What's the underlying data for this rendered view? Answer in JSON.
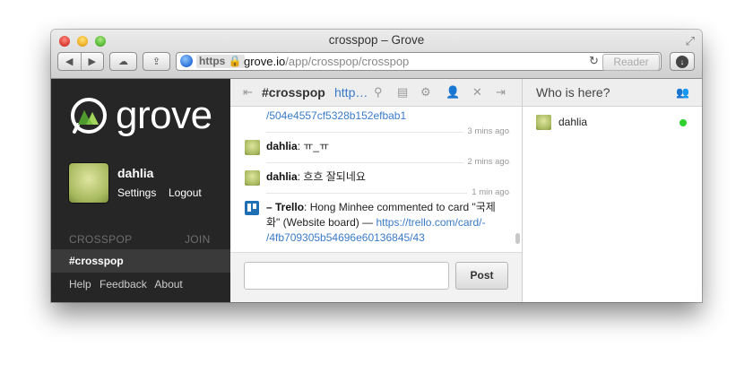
{
  "window": {
    "title": "crosspop – Grove"
  },
  "toolbar": {
    "back_icon": "back-arrow-icon",
    "forward_icon": "forward-arrow-icon",
    "cloud_icon": "cloud-icon",
    "share_icon": "share-icon",
    "url_scheme": "https",
    "url_domain": "grove.io",
    "url_path": "/app/crosspop/crosspop",
    "reader_label": "Reader"
  },
  "sidebar": {
    "logo_text": "grove",
    "user": {
      "name": "dahlia",
      "settings_label": "Settings",
      "logout_label": "Logout"
    },
    "org_label": "CROSSPOP",
    "join_label": "JOIN",
    "channels": [
      {
        "label": "#crosspop",
        "active": true
      }
    ],
    "footer": {
      "help": "Help",
      "feedback": "Feedback",
      "about": "About"
    }
  },
  "channel": {
    "name": "#crosspop",
    "url_truncated": "http…",
    "messages": [
      {
        "link_tail": "/504e4557cf5328b152efbab1",
        "timestamp": "3 mins ago"
      },
      {
        "author": "dahlia",
        "text": ": ㅠ_ㅠ",
        "timestamp": "2 mins ago"
      },
      {
        "author": "dahlia",
        "text": ": 흐흐 잘되네요",
        "timestamp": "1 min ago"
      },
      {
        "author": "– Trello",
        "text_pre": ": Hong Minhee commented to card \"국제",
        "text_mid": "화\" (Website board) — ",
        "link_part1": "https://trello.com/card/-",
        "link_part2": "/4fb709305b54696e60136845/43"
      }
    ],
    "composer": {
      "placeholder": "",
      "post_label": "Post"
    }
  },
  "presence": {
    "title": "Who is here?",
    "members": [
      {
        "name": "dahlia",
        "status": "online"
      }
    ]
  },
  "colors": {
    "sidebar_bg": "#262626",
    "link": "#3a7bc8",
    "online": "#2ed12e"
  }
}
